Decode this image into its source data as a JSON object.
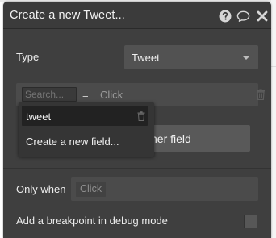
{
  "header": {
    "title": "Create a new Tweet...",
    "help_icon": "question-circle-icon",
    "comment_icon": "speech-bubble-icon",
    "close_icon": "close-icon"
  },
  "type_row": {
    "label": "Type",
    "value": "Tweet"
  },
  "field_row": {
    "search_placeholder": "Search...",
    "operator": "=",
    "value": "Click"
  },
  "popup": {
    "items": [
      {
        "label": "tweet"
      }
    ],
    "create_label": "Create a new field..."
  },
  "button_partial": {
    "label": "ner field"
  },
  "only_when": {
    "label": "Only when",
    "placeholder": "Click"
  },
  "breakpoint": {
    "label": "Add a breakpoint in debug mode"
  },
  "colors": {
    "panel": "#3f3f3f",
    "header": "#3b3b3b",
    "input": "#4b4b4b",
    "popup": "#353535",
    "text": "#f0f0f0"
  }
}
